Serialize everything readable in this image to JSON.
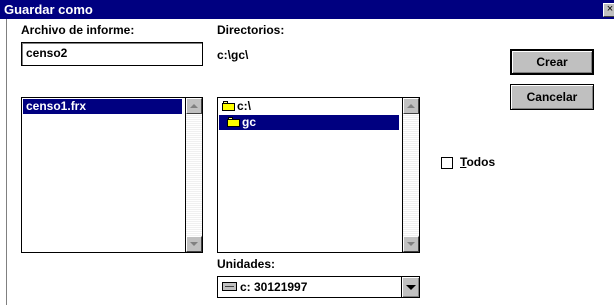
{
  "window": {
    "title": "Guardar como",
    "close_glyph": "×"
  },
  "report_file": {
    "label": "Archivo de informe:",
    "value": "censo2",
    "files": [
      {
        "name": "censo1.frx",
        "selected": true
      }
    ]
  },
  "directories": {
    "label": "Directorios:",
    "current_path": "c:\\gc\\",
    "items": [
      {
        "name": "c:\\",
        "icon": "open-folder-icon",
        "selected": false
      },
      {
        "name": "gc",
        "icon": "open-folder-icon",
        "selected": true
      }
    ]
  },
  "drives": {
    "label": "Unidades:",
    "selected": "c: 30121997",
    "icon": "drive-icon"
  },
  "buttons": {
    "create": "Crear",
    "cancel": "Cancelar"
  },
  "all_checkbox": {
    "label_accel": "T",
    "label_rest": "odos",
    "checked": false
  },
  "colors": {
    "title_bar": "#000080",
    "selection": "#000080",
    "button_face": "#c0c0c0"
  }
}
